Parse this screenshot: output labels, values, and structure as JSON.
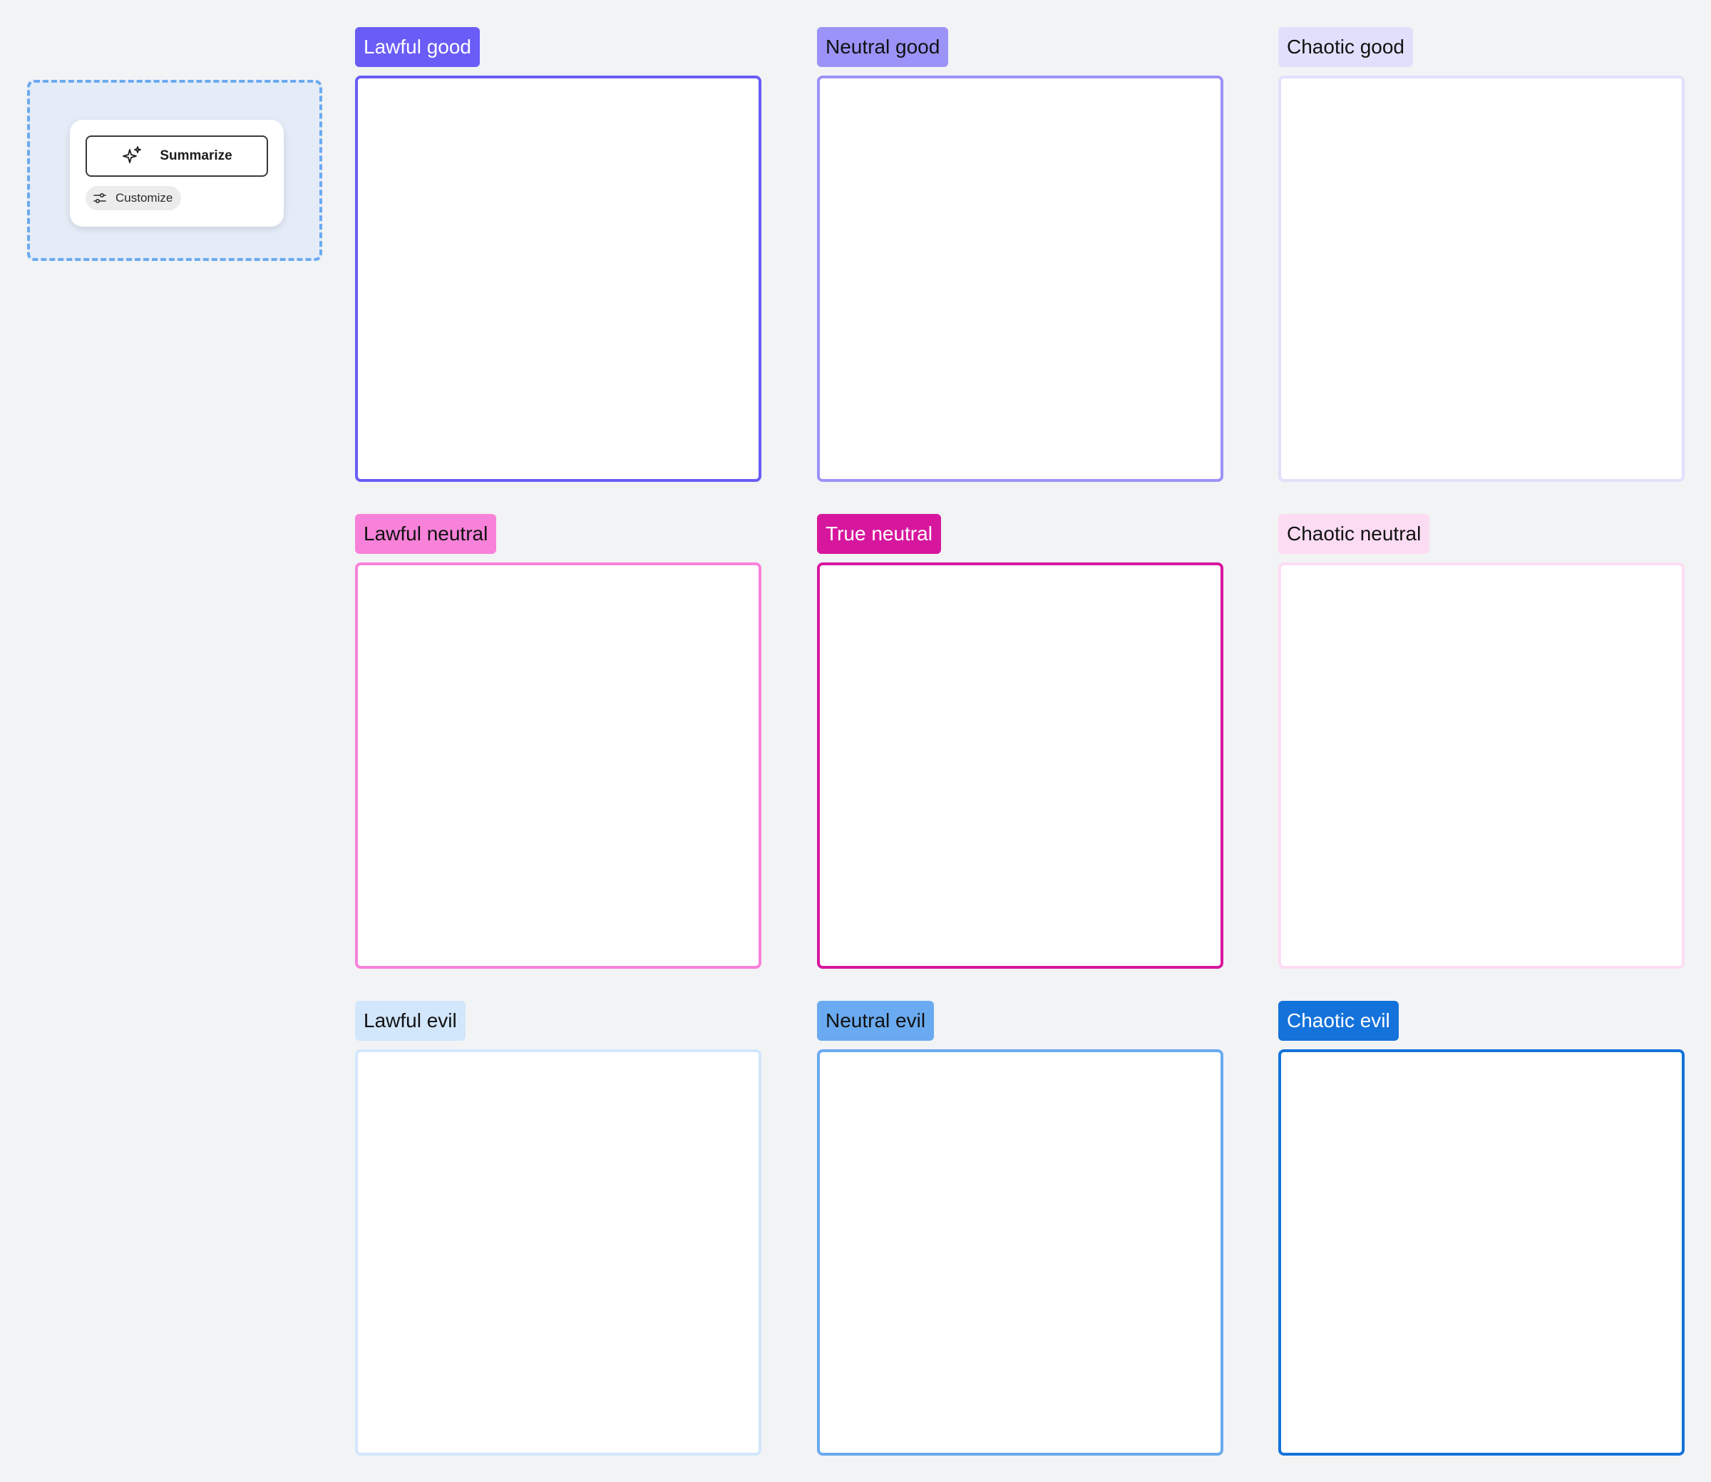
{
  "widget": {
    "summarize_label": "Summarize",
    "summarize_icon": "sparkle-icon",
    "customize_label": "Customize",
    "customize_icon": "sliders-icon"
  },
  "grid": [
    {
      "label": "Lawful good",
      "tag_bg": "#6a5cf6",
      "tag_fg": "#ffffff",
      "border": "#6a5cf6"
    },
    {
      "label": "Neutral good",
      "tag_bg": "#9b93f8",
      "tag_fg": "#111111",
      "border": "#9b93f8"
    },
    {
      "label": "Chaotic good",
      "tag_bg": "#e1e0fc",
      "tag_fg": "#111111",
      "border": "#e1e0fc"
    },
    {
      "label": "Lawful neutral",
      "tag_bg": "#f882da",
      "tag_fg": "#111111",
      "border": "#f882da"
    },
    {
      "label": "True neutral",
      "tag_bg": "#d6179e",
      "tag_fg": "#ffffff",
      "border": "#d6179e"
    },
    {
      "label": "Chaotic neutral",
      "tag_bg": "#fcdcf3",
      "tag_fg": "#111111",
      "border": "#fcdcf3"
    },
    {
      "label": "Lawful evil",
      "tag_bg": "#d2e6fc",
      "tag_fg": "#111111",
      "border": "#d2e6fc"
    },
    {
      "label": "Neutral evil",
      "tag_bg": "#6aaaf0",
      "tag_fg": "#111111",
      "border": "#6aaaf0"
    },
    {
      "label": "Chaotic evil",
      "tag_bg": "#1472db",
      "tag_fg": "#ffffff",
      "border": "#1472db"
    }
  ]
}
